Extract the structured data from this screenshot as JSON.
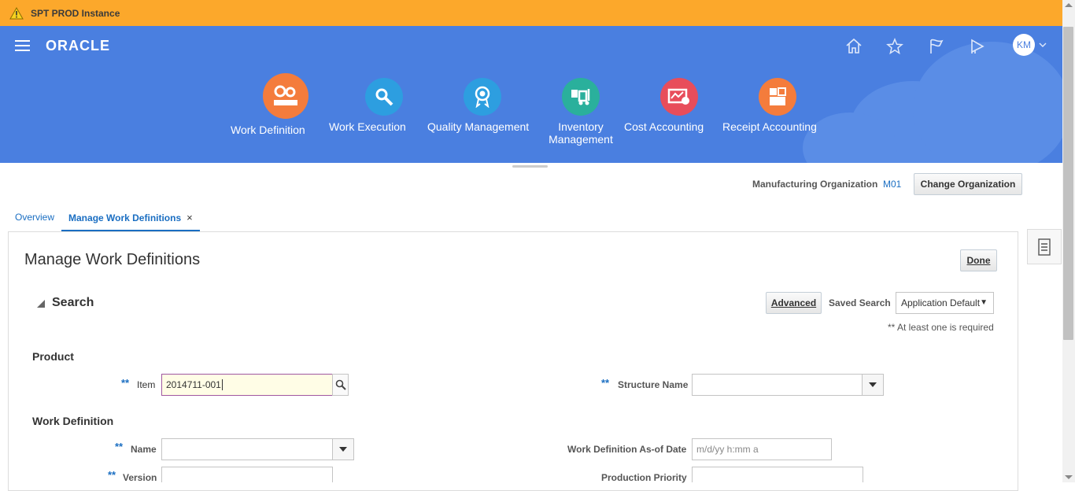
{
  "banner": {
    "text": "SPT PROD Instance"
  },
  "header": {
    "logo": "ORACLE",
    "avatar_initials": "KM",
    "apps": [
      {
        "label": "Work Definition",
        "color": "#f47c3c"
      },
      {
        "label": "Work Execution",
        "color": "#2d9ee0"
      },
      {
        "label": "Quality Management",
        "color": "#2d9ee0"
      },
      {
        "label": "Inventory Management",
        "color": "#2ab09c"
      },
      {
        "label": "Cost Accounting",
        "color": "#e84d5b"
      },
      {
        "label": "Receipt Accounting",
        "color": "#f47c3c"
      }
    ]
  },
  "org": {
    "label": "Manufacturing Organization",
    "value": "M01",
    "change_button": "Change Organization"
  },
  "tabs": [
    {
      "label": "Overview"
    },
    {
      "label": "Manage Work Definitions",
      "close": "×"
    }
  ],
  "page": {
    "title": "Manage Work Definitions",
    "done_button": "Done",
    "search": {
      "title": "Search",
      "advanced_button": "Advanced",
      "saved_search_label": "Saved Search",
      "saved_search_value": "Application Default",
      "required_note": "** At least one is required"
    },
    "product": {
      "section": "Product",
      "item_label": "Item",
      "item_value": "2014711-001",
      "structure_label": "Structure Name",
      "structure_value": ""
    },
    "work_definition": {
      "section": "Work Definition",
      "name_label": "Name",
      "name_value": "",
      "asof_label": "Work Definition As-of Date",
      "asof_placeholder": "m/d/yy h:mm a",
      "version_label": "Version",
      "priority_label": "Production Priority"
    },
    "req_marker": "**"
  }
}
